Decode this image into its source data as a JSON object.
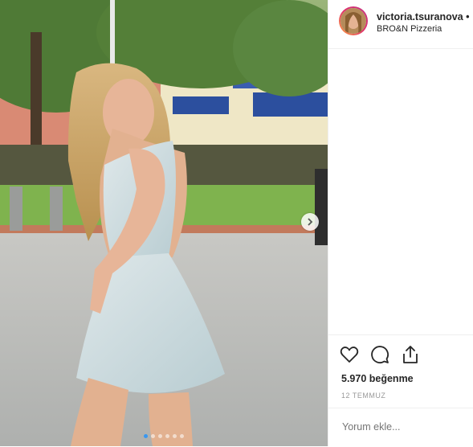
{
  "post": {
    "username": "victoria.tsuranova",
    "separator": "•",
    "location": "BRO&N Pizzeria",
    "likes": "5.970 beğenme",
    "date": "12 TEMMUZ",
    "comment_placeholder": "Yorum ekle..."
  },
  "carousel": {
    "dots": 6,
    "active": 0
  },
  "icons": {
    "like": "heart-outline-icon",
    "comment": "speech-bubble-icon",
    "share": "share-upload-icon",
    "next": "chevron-right-icon"
  },
  "colors": {
    "accent": "#3897f0",
    "text": "#262626",
    "muted": "#999999",
    "border": "#efefef"
  }
}
